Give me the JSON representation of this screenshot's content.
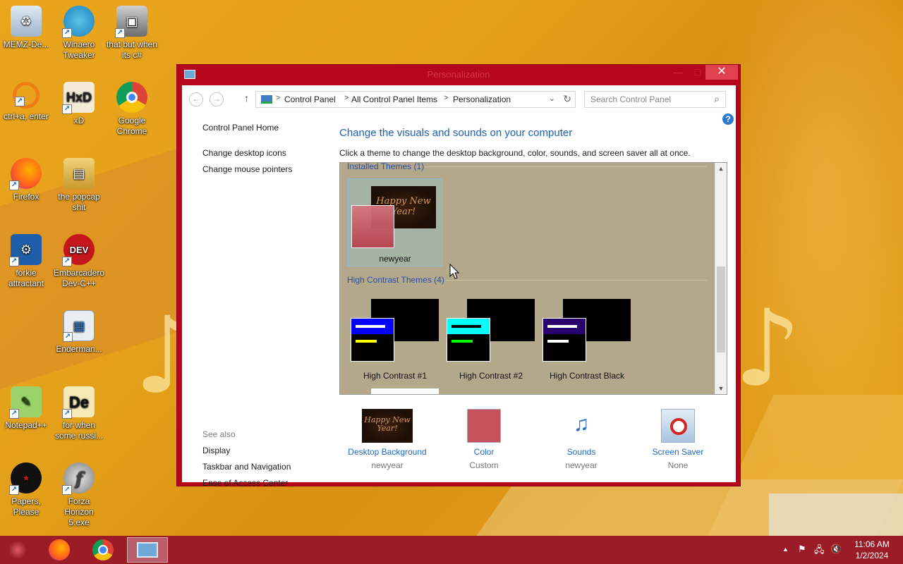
{
  "desktop": {
    "icons": [
      {
        "label": "MEMZ-De...",
        "icon": "recycle-bin-icon"
      },
      {
        "label": "Winaero Tweaker",
        "icon": "winaero-icon"
      },
      {
        "label": "that but when its c#",
        "icon": "stacked-windows-icon"
      },
      {
        "label": "ctrl+a, enter",
        "icon": "magnifier-icon"
      },
      {
        "label": "xD",
        "icon": "hxd-icon"
      },
      {
        "label": "Google Chrome",
        "icon": "chrome-icon"
      },
      {
        "label": "Firefox",
        "icon": "firefox-icon"
      },
      {
        "label": "the popcap shit",
        "icon": "folder-icon"
      },
      {
        "label": "forkie attractant",
        "icon": "monitor-gear-icon"
      },
      {
        "label": "Embarcadero Dev-C++",
        "icon": "devcpp-icon"
      },
      {
        "label": "Enderman...",
        "icon": "app-window-icon"
      },
      {
        "label": "Notepad++",
        "icon": "notepadpp-icon"
      },
      {
        "label": "for when some russi...",
        "icon": "de-icon"
      },
      {
        "label": "Papers, Please",
        "icon": "papers-please-icon"
      },
      {
        "label": "Forza Horizon 5.exe",
        "icon": "flash-icon"
      }
    ]
  },
  "window": {
    "title": "Personalization",
    "min": "—",
    "max": "□",
    "close": "✕"
  },
  "address": {
    "back": "←",
    "forward": "→",
    "up": "↑",
    "crumbs": [
      "Control Panel",
      "All Control Panel Items",
      "Personalization"
    ],
    "sep": ">",
    "dropdown": "⌄",
    "refresh": "↻",
    "search_placeholder": "Search Control Panel",
    "search_icon": "⌕"
  },
  "help": "?",
  "left_pane": {
    "home": "Control Panel Home",
    "links": [
      "Change desktop icons",
      "Change mouse pointers"
    ],
    "see_also_title": "See also",
    "see_also": [
      "Display",
      "Taskbar and Navigation",
      "Ease of Access Center"
    ]
  },
  "main": {
    "title": "Change the visuals and sounds on your computer",
    "description": "Click a theme to change the desktop background, color, sounds, and screen saver all at once.",
    "installed_header": "Installed Themes (1)",
    "installed": [
      {
        "name": "newyear",
        "preview_text": "Happy New Year!"
      }
    ],
    "hc_header": "High Contrast Themes (4)",
    "hc_themes": [
      {
        "name": "High Contrast #1",
        "accent": "#0000ff",
        "bar2": "#ffff00"
      },
      {
        "name": "High Contrast #2",
        "accent": "#00ffff",
        "bar2": "#00ff00"
      },
      {
        "name": "High Contrast Black",
        "accent": "#2a006f",
        "bar2": "#ffffff"
      }
    ],
    "scroll_up": "▲",
    "scroll_down": "▼"
  },
  "bottom": [
    {
      "label": "Desktop Background",
      "sub": "newyear",
      "preview_text": "Happy New Year!"
    },
    {
      "label": "Color",
      "sub": "Custom",
      "swatch": "#c6505c"
    },
    {
      "label": "Sounds",
      "sub": "newyear"
    },
    {
      "label": "Screen Saver",
      "sub": "None"
    }
  ],
  "taskbar": {
    "clock_time": "11:06 AM",
    "clock_date": "1/2/2024",
    "tray": [
      "▲",
      "⚑",
      "🖧",
      "🔇"
    ]
  }
}
